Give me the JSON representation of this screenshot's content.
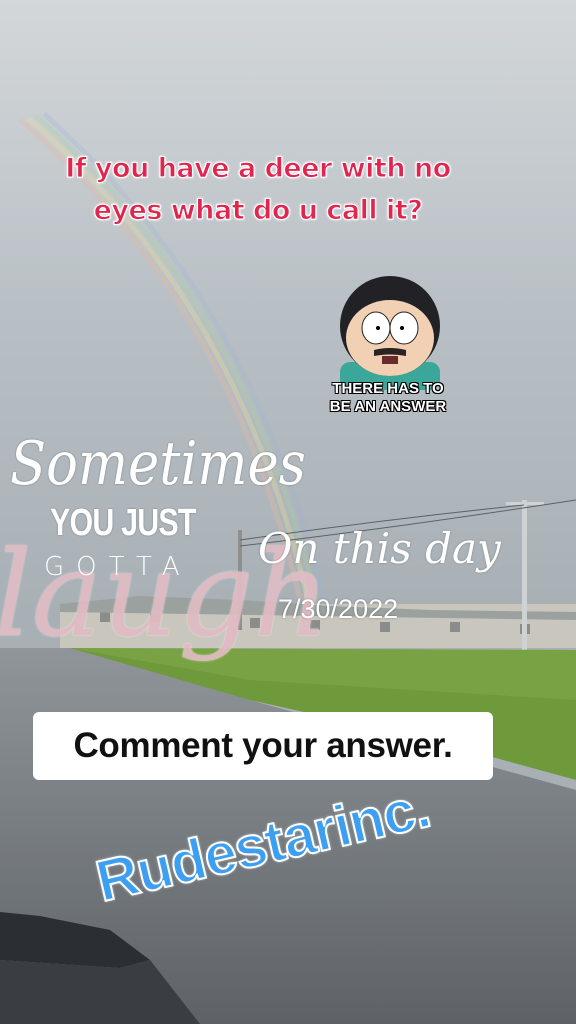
{
  "question": {
    "line1": "If you have a deer with no",
    "line2": "eyes what do u call it?"
  },
  "reaction": {
    "line1": "THERE HAS TO",
    "line2": "BE AN ANSWER"
  },
  "sticker": {
    "sometimes": "Sometimes",
    "you_just": "YOU JUST",
    "gotta": "GOTTA",
    "laugh": "laugh"
  },
  "memory": {
    "title": "On this day",
    "date": "7/30/2022"
  },
  "prompt": {
    "label": "Comment your answer."
  },
  "watermark": {
    "text": "Rudestarinc."
  },
  "colors": {
    "question_red": "#e0264f",
    "brand_blue": "#3d9ff2",
    "laugh_pink": "#e2bcc4"
  }
}
